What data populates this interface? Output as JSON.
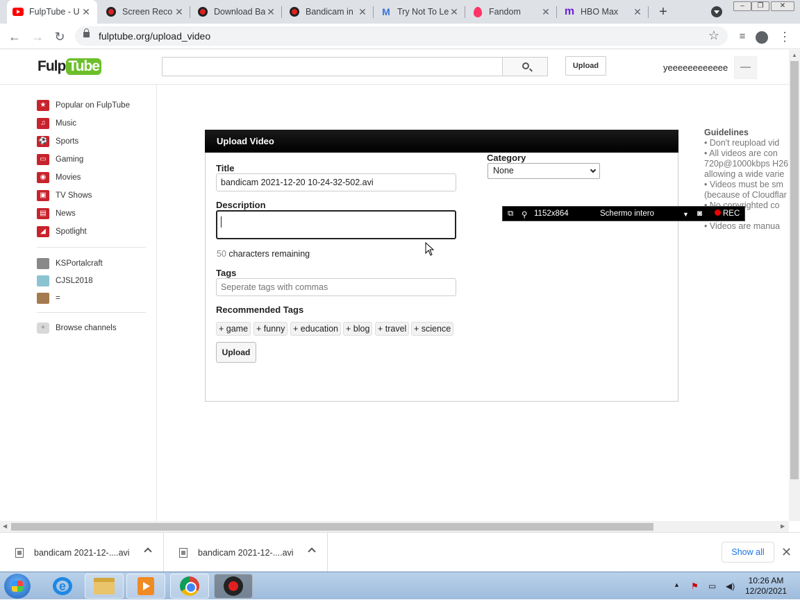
{
  "browser": {
    "tabs": [
      {
        "label": "FulpTube - U",
        "favicon": "fulptube-icon",
        "active": true
      },
      {
        "label": "Screen Reco",
        "favicon": "bandicam-icon"
      },
      {
        "label": "Download Ba",
        "favicon": "bandicam-icon"
      },
      {
        "label": "Bandicam in",
        "favicon": "bandicam-icon"
      },
      {
        "label": "Try Not To Le",
        "favicon": "m-icon"
      },
      {
        "label": "Fandom",
        "favicon": "fandom-icon"
      },
      {
        "label": "HBO Max",
        "favicon": "hbo-icon"
      }
    ],
    "url": "fulptube.org/upload_video"
  },
  "site": {
    "logo_part1": "Fulp",
    "logo_part2": "Tube",
    "search_placeholder": "",
    "header_upload": "Upload",
    "username": "yeeeeeeeeeeee"
  },
  "sidebar": {
    "nav": [
      {
        "label": "Popular on FulpTube",
        "icon": "star-icon"
      },
      {
        "label": "Music",
        "icon": "headphones-icon"
      },
      {
        "label": "Sports",
        "icon": "sports-icon"
      },
      {
        "label": "Gaming",
        "icon": "gamepad-icon"
      },
      {
        "label": "Movies",
        "icon": "film-icon"
      },
      {
        "label": "TV Shows",
        "icon": "tv-icon"
      },
      {
        "label": "News",
        "icon": "news-icon"
      },
      {
        "label": "Spotlight",
        "icon": "spotlight-icon"
      }
    ],
    "subscriptions": [
      {
        "label": "KSPortalcraft",
        "icon": "channel-avatar-icon"
      },
      {
        "label": "CJSL2018",
        "icon": "channel-avatar-icon"
      },
      {
        "label": "=",
        "icon": "channel-avatar-icon"
      }
    ],
    "browse_channels": "Browse channels"
  },
  "upload": {
    "header": "Upload Video",
    "title_label": "Title",
    "title_value": "bandicam 2021-12-20 10-24-32-502.avi",
    "description_label": "Description",
    "description_value": "",
    "chars_count": "50",
    "chars_text": "characters remaining",
    "tags_label": "Tags",
    "tags_placeholder": "Seperate tags with commas",
    "recommended_label": "Recommended Tags",
    "recommended_tags": [
      "+ game",
      "+ funny",
      "+ education",
      "+ blog",
      "+ travel",
      "+ science"
    ],
    "submit": "Upload",
    "category_label": "Category",
    "category_value": "None"
  },
  "guidelines": {
    "title": "Guidelines",
    "lines": [
      "•   Don't reupload vid",
      "•   All videos are con",
      "720p@1000kbps H26",
      "allowing a wide varie",
      "•   Videos must be sm",
      "(because of Cloudflar",
      "•   No copyrighted co",
      "",
      "•   Videos are manua"
    ]
  },
  "bandicam": {
    "resolution": "1152x864",
    "mode": "Schermo intero",
    "rec": "REC"
  },
  "downloads": {
    "items": [
      "bandicam 2021-12-....avi",
      "bandicam 2021-12-....avi"
    ],
    "show_all": "Show all"
  },
  "taskbar": {
    "time": "10:26 AM",
    "date": "12/20/2021"
  }
}
